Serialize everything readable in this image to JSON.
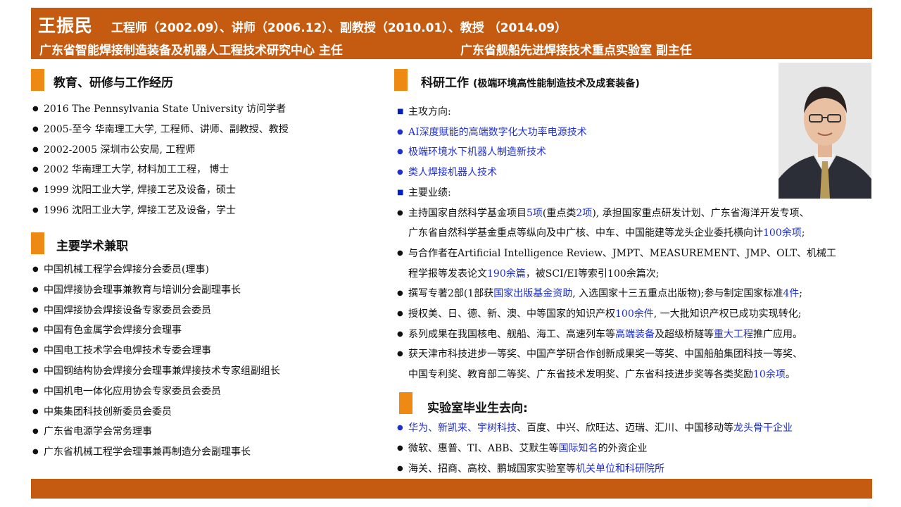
{
  "header": {
    "name": "王振民",
    "titles": "工程师（2002.09）、讲师（2006.12）、副教授（2010.01）、教授 （2014.09）",
    "org1": "广东省智能焊接制造装备及机器人工程技术研究中心 主任",
    "org2": "广东省舰船先进焊接技术重点实验室 副主任"
  },
  "education": {
    "title": "教育、研修与工作经历",
    "items": [
      "2016  The Pennsylvania  State University 访问学者",
      "2005-至今 华南理工大学, 工程师、讲师、副教授、教授",
      "2002-2005 深圳市公安局, 工程师",
      "2002  华南理工大学, 材料加工工程，  博士",
      "1999  沈阳工业大学, 焊接工艺及设备，硕士",
      "1996  沈阳工业大学, 焊接工艺及设备，学士"
    ]
  },
  "academic": {
    "title": "主要学术兼职",
    "items": [
      "中国机械工程学会焊接分会委员(理事)",
      "中国焊接协会理事兼教育与培训分会副理事长",
      "中国焊接协会焊接设备专家委员会委员",
      "中国有色金属学会焊接分会理事",
      "中国电工技术学会电焊技术专委会理事",
      "中国钢结构协会焊接分会理事兼焊接技术专家组副组长",
      "中国机电一体化应用协会专家委员会委员",
      "中集集团科技创新委员会委员",
      "广东省电源学会常务理事",
      "广东省机械工程学会理事兼再制造分会副理事长"
    ]
  },
  "research": {
    "title": "科研工作",
    "subtitle": "(极端环境高性能制造技术及成套装备)",
    "directions_label": "主攻方向:",
    "directions": [
      "AI深度赋能的高端数字化大功率电源技术",
      "极端环境水下机器人制造新技术",
      "类人焊接机器人技术"
    ],
    "achievements_label": "主要业绩:",
    "a1": {
      "p1": "主持国家自然科学基金项目",
      "b1": "5项",
      "p2": "(重点类",
      "b2": "2项",
      "p3": "), 承担国家重点研发计划、广东省海洋开发专项、",
      "l2a": "广东省自然科学基金重点等纵向及中广核、中车、中国能建等龙头企业委托横向计",
      "l2b": "100余项",
      "l2c": ";"
    },
    "a2": {
      "l1": "与合作者在Artificial  Intelligence  Review、JMPT、MEASUREMENT、JMP、OLT、机械工",
      "l2a": "程学报等发表论文",
      "l2b": "190余篇",
      "l2c": "，被SCI/EI等索引100余篇次;"
    },
    "a3": {
      "p1": "撰写专著2部(1部获",
      "b1": "国家出版基金资助",
      "p2": ", 入选国家十三五重点出版物);参与制定国家标准",
      "b2": "4件",
      "p3": ";"
    },
    "a4": {
      "p1": "授权美、日、德、新、澳、中等国家的知识产权",
      "b1": "100余件",
      "p2": ", 一大批知识产权已成功实现转化;"
    },
    "a5": {
      "p1": "系列成果在我国核电、舰船、海工、高速列车等",
      "b1": "高端装备",
      "p2": "及超级桥隧等",
      "b2": "重大工程",
      "p3": "推广应用。"
    },
    "a6": {
      "l1": "获天津市科技进步一等奖、中国产学研合作创新成果奖一等奖、中国船舶集团科技一等奖、",
      "l2a": "中国专利奖、教育部二等奖、广东省技术发明奖、广东省科技进步奖等各类奖励",
      "l2b": "10余项",
      "l2c": "。"
    }
  },
  "graduates": {
    "title": "实验室毕业生去向:",
    "g1a": "华为、新凯来、宇树科技",
    "g1b": "、百度、中兴、欣旺达、迈瑞、汇川、中国移动等",
    "g1c": "龙头骨干企业",
    "g2a": "微软、惠普、TI、ABB、艾默生等",
    "g2b": "国际知名",
    "g2c": "的外资企业",
    "g3a": "海关、招商、高校、鹏城国家实验室等",
    "g3b": "机关单位和科研院所"
  }
}
